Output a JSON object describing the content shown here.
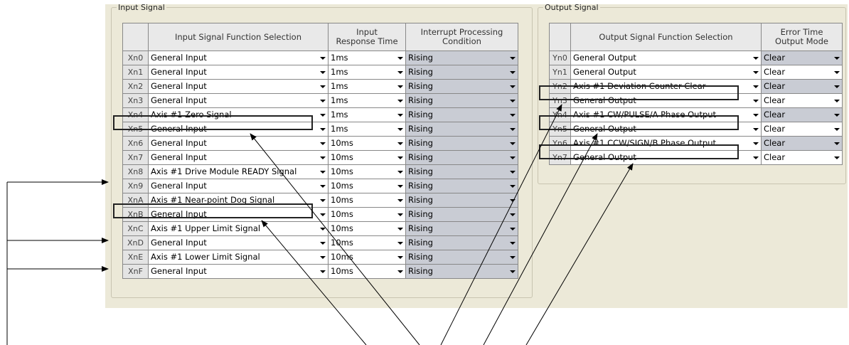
{
  "input_group": {
    "title": "Input Signal",
    "headers": {
      "function": "Input Signal Function Selection",
      "response_1": "Input",
      "response_2": "Response Time",
      "interrupt_1": "Interrupt Processing",
      "interrupt_2": "Condition"
    },
    "rows": [
      {
        "id": "Xn0",
        "function": "General Input",
        "response": "1ms",
        "interrupt": "Rising"
      },
      {
        "id": "Xn1",
        "function": "General Input",
        "response": "1ms",
        "interrupt": "Rising"
      },
      {
        "id": "Xn2",
        "function": "General Input",
        "response": "1ms",
        "interrupt": "Rising"
      },
      {
        "id": "Xn3",
        "function": "General Input",
        "response": "1ms",
        "interrupt": "Rising"
      },
      {
        "id": "Xn4",
        "function": "Axis #1 Zero Signal",
        "response": "1ms",
        "interrupt": "Rising"
      },
      {
        "id": "Xn5",
        "function": "General Input",
        "response": "1ms",
        "interrupt": "Rising"
      },
      {
        "id": "Xn6",
        "function": "General Input",
        "response": "10ms",
        "interrupt": "Rising"
      },
      {
        "id": "Xn7",
        "function": "General Input",
        "response": "10ms",
        "interrupt": "Rising"
      },
      {
        "id": "Xn8",
        "function": "Axis #1 Drive Module READY Signal",
        "response": "10ms",
        "interrupt": "Rising"
      },
      {
        "id": "Xn9",
        "function": "General Input",
        "response": "10ms",
        "interrupt": "Rising"
      },
      {
        "id": "XnA",
        "function": "Axis #1 Near-point Dog Signal",
        "response": "10ms",
        "interrupt": "Rising"
      },
      {
        "id": "XnB",
        "function": "General Input",
        "response": "10ms",
        "interrupt": "Rising"
      },
      {
        "id": "XnC",
        "function": "Axis #1 Upper Limit Signal",
        "response": "10ms",
        "interrupt": "Rising"
      },
      {
        "id": "XnD",
        "function": "General Input",
        "response": "10ms",
        "interrupt": "Rising"
      },
      {
        "id": "XnE",
        "function": "Axis #1 Lower Limit Signal",
        "response": "10ms",
        "interrupt": "Rising"
      },
      {
        "id": "XnF",
        "function": "General Input",
        "response": "10ms",
        "interrupt": "Rising"
      }
    ]
  },
  "output_group": {
    "title": "Output Signal",
    "headers": {
      "function": "Output Signal Function Selection",
      "error_1": "Error Time",
      "error_2": "Output Mode"
    },
    "rows": [
      {
        "id": "Yn0",
        "function": "General Output",
        "mode": "Clear"
      },
      {
        "id": "Yn1",
        "function": "General Output",
        "mode": "Clear"
      },
      {
        "id": "Yn2",
        "function": "Axis #1 Deviation Counter Clear",
        "mode": "Clear"
      },
      {
        "id": "Yn3",
        "function": "General Output",
        "mode": "Clear"
      },
      {
        "id": "Yn4",
        "function": "Axis #1 CW/PULSE/A Phase Output",
        "mode": "Clear"
      },
      {
        "id": "Yn5",
        "function": "General Output",
        "mode": "Clear"
      },
      {
        "id": "Yn6",
        "function": "Axis #1 CCW/SIGN/B Phase Output",
        "mode": "Clear"
      },
      {
        "id": "Yn7",
        "function": "General Output",
        "mode": "Clear"
      }
    ]
  },
  "icons": {
    "dropdown": "chevron-down-icon"
  },
  "colors": {
    "panel_bg": "#ece9d8",
    "grey_cell": "#c9ccd4",
    "header_bg": "#e9e9e9"
  }
}
